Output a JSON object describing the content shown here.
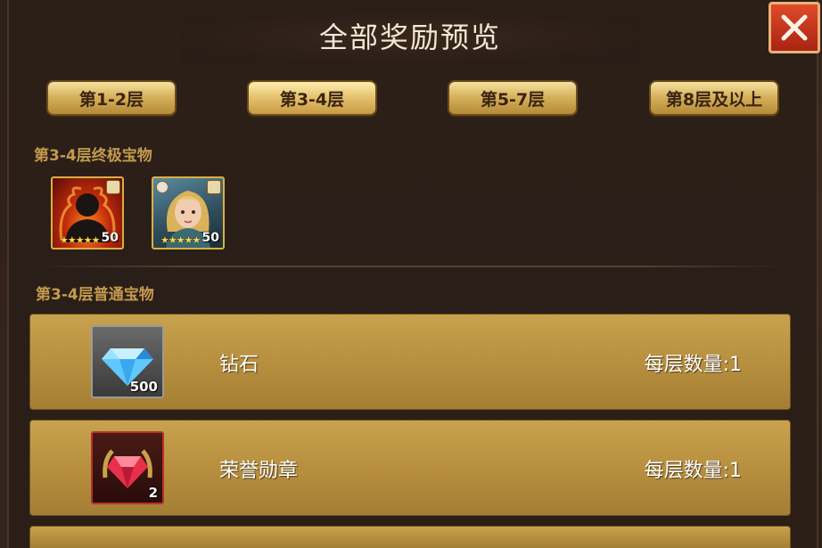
{
  "title": "全部奖励预览",
  "tabs": [
    {
      "label": "第1-2层"
    },
    {
      "label": "第3-4层"
    },
    {
      "label": "第5-7层"
    },
    {
      "label": "第8层及以上"
    }
  ],
  "selected_tab": "第3-4层",
  "ultimate": {
    "label": "第3-4层终极宝物",
    "items": [
      {
        "icon": "silhouette-hero-icon",
        "stars": "★★★★★",
        "level": "50"
      },
      {
        "icon": "female-hero-portrait-icon",
        "stars": "★★★★★",
        "level": "50"
      }
    ]
  },
  "normal": {
    "label": "第3-4层普通宝物",
    "items": [
      {
        "icon": "diamond-icon",
        "name": "钻石",
        "qty": "500",
        "count": "每层数量:1"
      },
      {
        "icon": "honor-medal-icon",
        "name": "荣誉勋章",
        "qty": "2",
        "count": "每层数量:1"
      }
    ]
  },
  "colors": {
    "gold_row": "#b48c3c",
    "label": "#c49a4e",
    "close": "#c8361c"
  }
}
